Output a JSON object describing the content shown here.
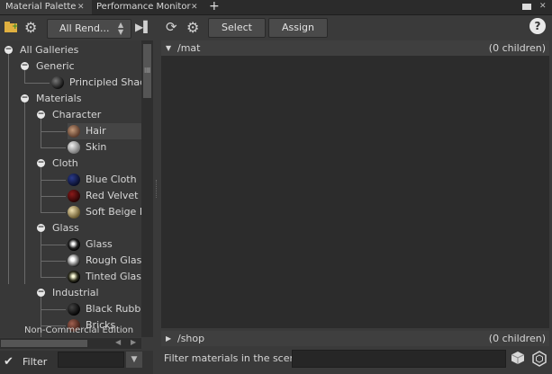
{
  "tabs": [
    {
      "label": "Material Palette",
      "active": true
    },
    {
      "label": "Performance Monitor",
      "active": false
    }
  ],
  "add_tab_symbol": "+",
  "left_toolbar": {
    "renderer_select": "All Rend..."
  },
  "right_toolbar": {
    "select_label": "Select",
    "assign_label": "Assign",
    "help_symbol": "?"
  },
  "tree": {
    "root": "All Galleries",
    "generic": {
      "label": "Generic",
      "items": [
        "Principled Shader"
      ]
    },
    "materials": {
      "label": "Materials",
      "character": {
        "label": "Character",
        "items": [
          "Hair",
          "Skin"
        ]
      },
      "cloth": {
        "label": "Cloth",
        "items": [
          "Blue Cloth",
          "Red Velvet",
          "Soft Beige Leather"
        ]
      },
      "glass": {
        "label": "Glass",
        "items": [
          "Glass",
          "Rough Glass",
          "Tinted Glass"
        ]
      },
      "industrial": {
        "label": "Industrial",
        "items": [
          "Black Rubber",
          "Bricks"
        ]
      }
    }
  },
  "watermark": "Non-Commercial Edition",
  "left_filter": {
    "label": "Filter",
    "value": ""
  },
  "mat_section": {
    "path": "/mat",
    "children": "(0 children)"
  },
  "shop_section": {
    "path": "/shop",
    "children": "(0 children)"
  },
  "scene_filter": {
    "label": "Filter materials in the scene:",
    "value": ""
  },
  "colors": {
    "background": "#3a3a3a",
    "panel_dark": "#2c2c2c",
    "tab_bar": "#2b2b2b"
  }
}
